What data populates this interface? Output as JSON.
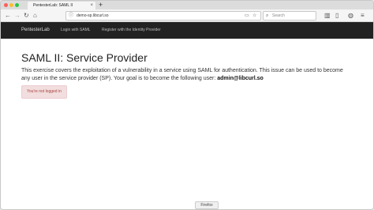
{
  "browser": {
    "tab_title": "PentesterLab: SAML II",
    "tab_close": "×",
    "new_tab": "+",
    "url": "demo-sp.libcurl.so",
    "search_placeholder": "Search",
    "statusbar": "Firefox",
    "icons": {
      "back": "back-icon",
      "forward": "forward-icon",
      "reload": "reload-icon",
      "home": "home-icon",
      "info": "info-icon",
      "menu": "hamburger-icon"
    }
  },
  "navbar": {
    "brand": "PentesterLab",
    "links": [
      "Login with SAML",
      "Register with the Identity Provider"
    ]
  },
  "main": {
    "title": "SAML II: Service Provider",
    "description": "This exercise covers the exploitation of a vulnerability in a service using SAML for authentication. This issue can be used to become any user in the service provider (SP). Your goal is to become the following user: ",
    "target_user": "admin@libcurl.so",
    "alert": "You're not logged in"
  },
  "colors": {
    "navbar_bg": "#222222",
    "alert_bg": "#f2dede",
    "alert_text": "#a94442"
  }
}
